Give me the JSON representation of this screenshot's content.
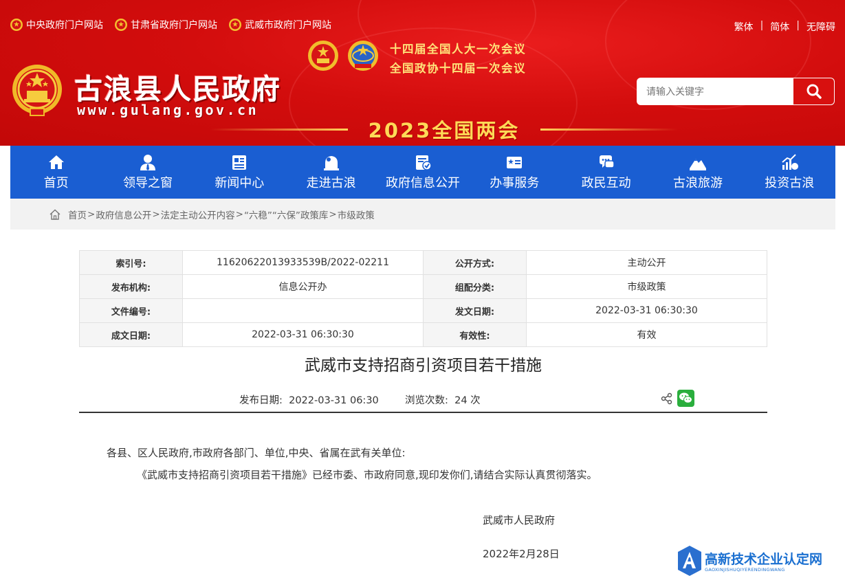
{
  "header": {
    "top_links": [
      {
        "label": "中央政府门户网站"
      },
      {
        "label": "甘肃省政府门户网站"
      },
      {
        "label": "武威市政府门户网站"
      }
    ],
    "lang_links": [
      "繁体",
      "简体",
      "无障碍"
    ],
    "lang_sep": "|",
    "site_title": "古浪县人民政府",
    "site_url": "www.gulang.gov.cn",
    "meeting_lines": [
      "十四届全国人大一次会议",
      "全国政协十四届一次会议"
    ],
    "lianghui": "2023全国两会",
    "search_placeholder": "请输入关键字",
    "accent_red": "#d30d0d",
    "gold": "#ffd957"
  },
  "nav": {
    "color": "#1a5ed2",
    "items": [
      {
        "label": "首页",
        "icon": "home-icon"
      },
      {
        "label": "领导之窗",
        "icon": "person-icon"
      },
      {
        "label": "新闻中心",
        "icon": "newspaper-icon"
      },
      {
        "label": "走进古浪",
        "icon": "landmark-icon"
      },
      {
        "label": "政府信息公开",
        "icon": "document-check-icon"
      },
      {
        "label": "办事服务",
        "icon": "id-card-icon"
      },
      {
        "label": "政民互动",
        "icon": "chat-icon"
      },
      {
        "label": "古浪旅游",
        "icon": "mountain-icon"
      },
      {
        "label": "投资古浪",
        "icon": "growth-chart-icon"
      }
    ]
  },
  "breadcrumb": {
    "items": [
      "首页",
      "政府信息公开",
      "法定主动公开内容",
      "“六稳”“六保”政策库",
      "市级政策"
    ],
    "sep": ">"
  },
  "meta": {
    "rows": [
      {
        "k1": "索引号:",
        "v1": "11620622013933539B/2022-02211",
        "k2": "公开方式:",
        "v2": "主动公开"
      },
      {
        "k1": "发布机构:",
        "v1": "信息公开办",
        "k2": "组配分类:",
        "v2": "市级政策"
      },
      {
        "k1": "文件编号:",
        "v1": "",
        "k2": "发文日期:",
        "v2": "2022-03-31 06:30:30"
      },
      {
        "k1": "成文日期:",
        "v1": "2022-03-31 06:30:30",
        "k2": "有效性:",
        "v2": "有效"
      }
    ]
  },
  "article": {
    "title": "武威市支持招商引资项目若干措施",
    "pub_label": "发布日期:",
    "pub_date": "2022-03-31 06:30",
    "views_label": "浏览次数:",
    "views": "24",
    "views_unit": "次",
    "p1": "各县、区人民政府,市政府各部门、单位,中央、省属在武有关单位:",
    "p2": "《武威市支持招商引资项目若干措施》已经市委、市政府同意,现印发你们,请结合实际认真贯彻落实。",
    "sign_org": "武威市人民政府",
    "sign_date": "2022年2月28日"
  },
  "watermark": {
    "main": "高新技术企业认定网",
    "sub": "GAOXINJISHUQIYERENDINGWANG"
  }
}
